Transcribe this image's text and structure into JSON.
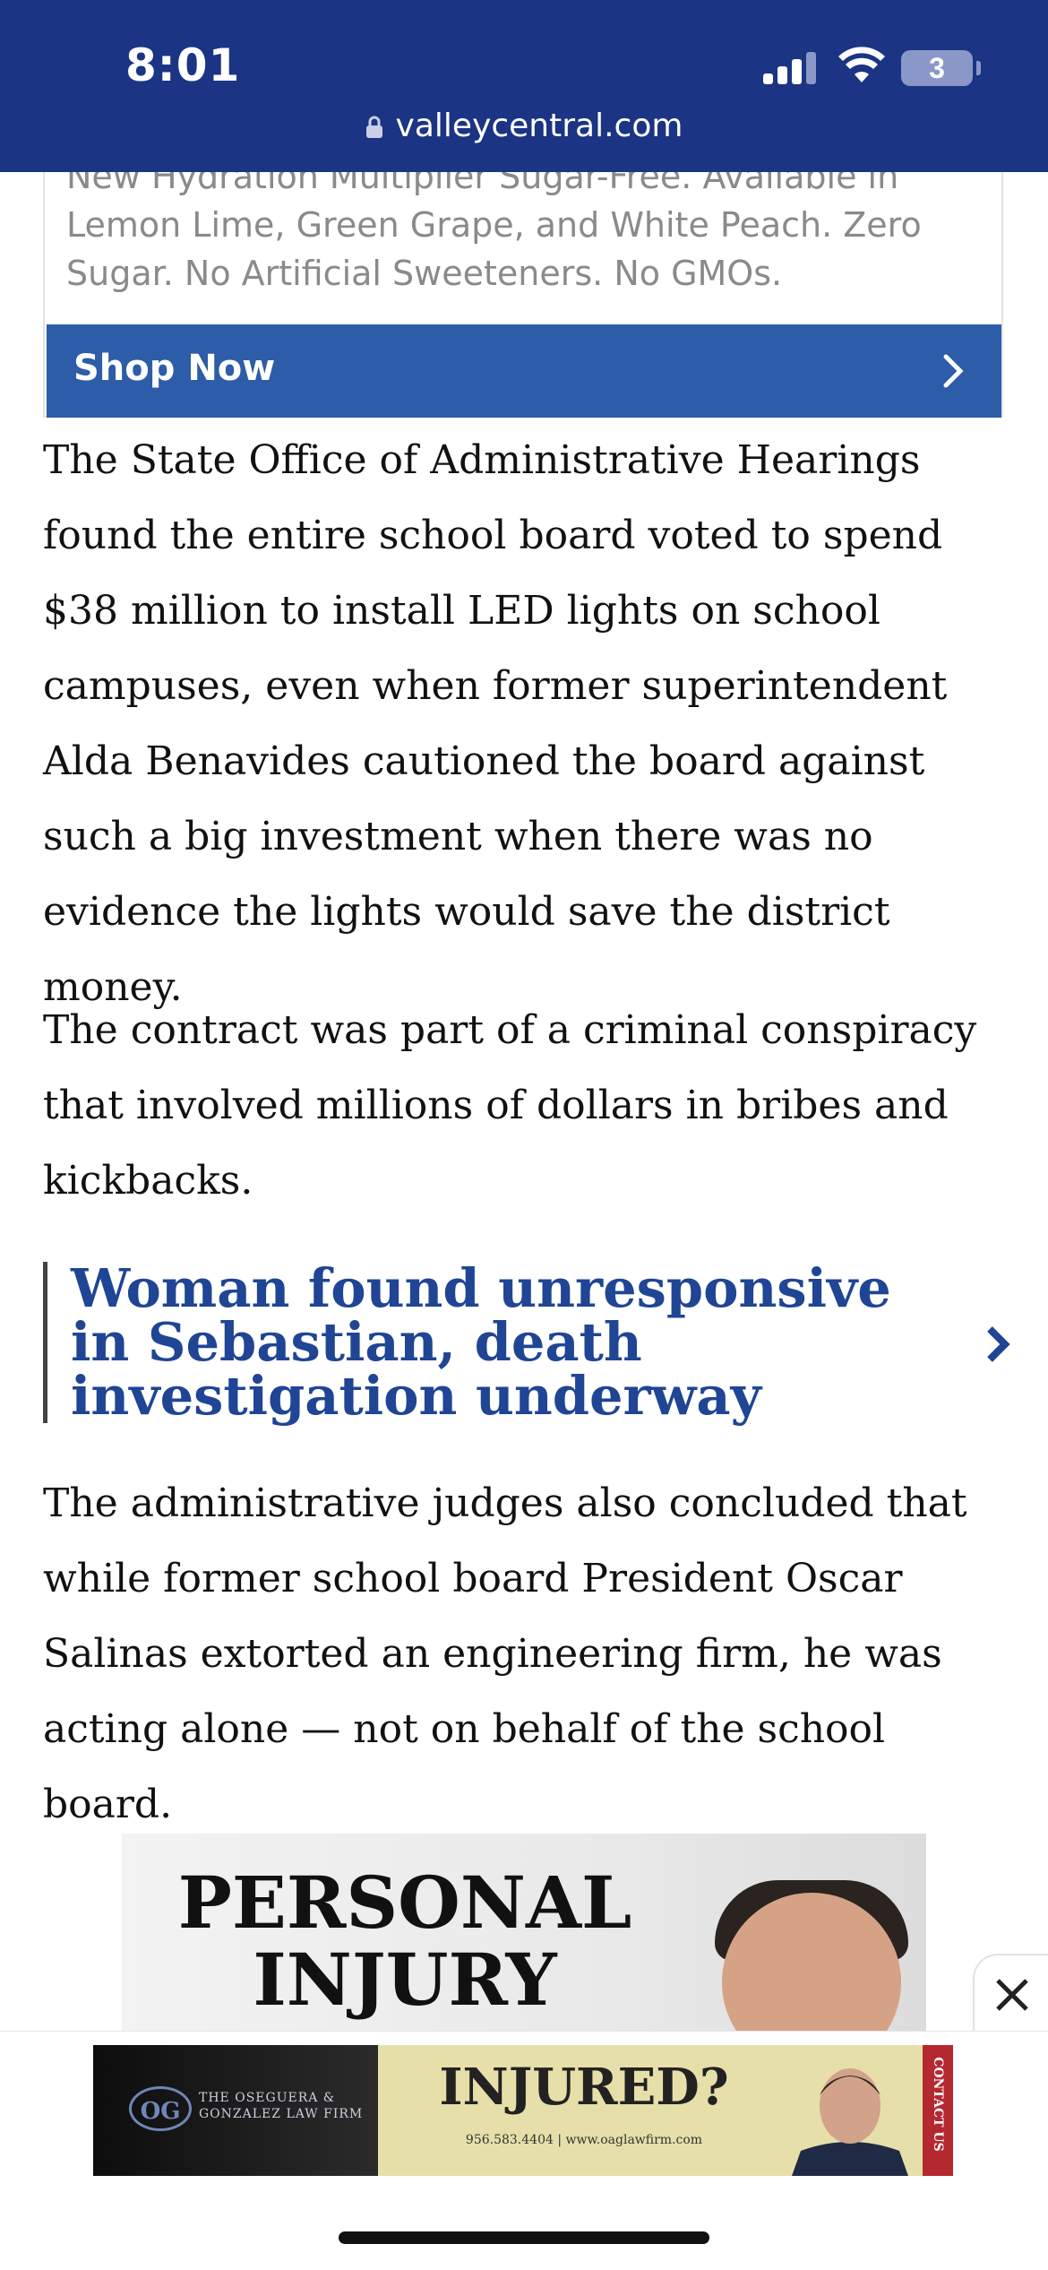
{
  "status_bar": {
    "time": "8:01",
    "battery": "3"
  },
  "browser": {
    "url": "valleycentral.com"
  },
  "ad_top": {
    "text": "New Hydration Multiplier Sugar-Free. Available in Lemon Lime, Green Grape, and White Peach. Zero Sugar. No Artificial Sweeteners. No GMOs.",
    "cta": "Shop Now"
  },
  "article": {
    "p1": "The State Office of Administrative Hearings found the entire school board voted to spend $38 million to install LED lights on school campuses, even when former superintendent Alda Benavides cautioned the board against such a big investment when there was no evidence the lights would save the district money.",
    "p2": "The contract was part of a criminal conspiracy that involved millions of dollars in bribes and kickbacks.",
    "related": "Woman found unresponsive in Sebastian, death investigation underway",
    "p3": "The administrative judges also concluded that while former school board President Oscar Salinas extorted an engineering firm, he was acting alone — not on behalf of the school board."
  },
  "image_ad": {
    "headline": "PERSONAL INJURY"
  },
  "bottom_ad": {
    "logo_mark": "OG",
    "firm": "THE OSEGUERA & GONZALEZ LAW FIRM",
    "headline": "INJURED?",
    "contact": "956.583.4404 | www.oaglawfirm.com",
    "side": "CONTACT US"
  },
  "colors": {
    "header": "#1b3483",
    "button": "#2d5ca8",
    "link": "#1f4594"
  }
}
